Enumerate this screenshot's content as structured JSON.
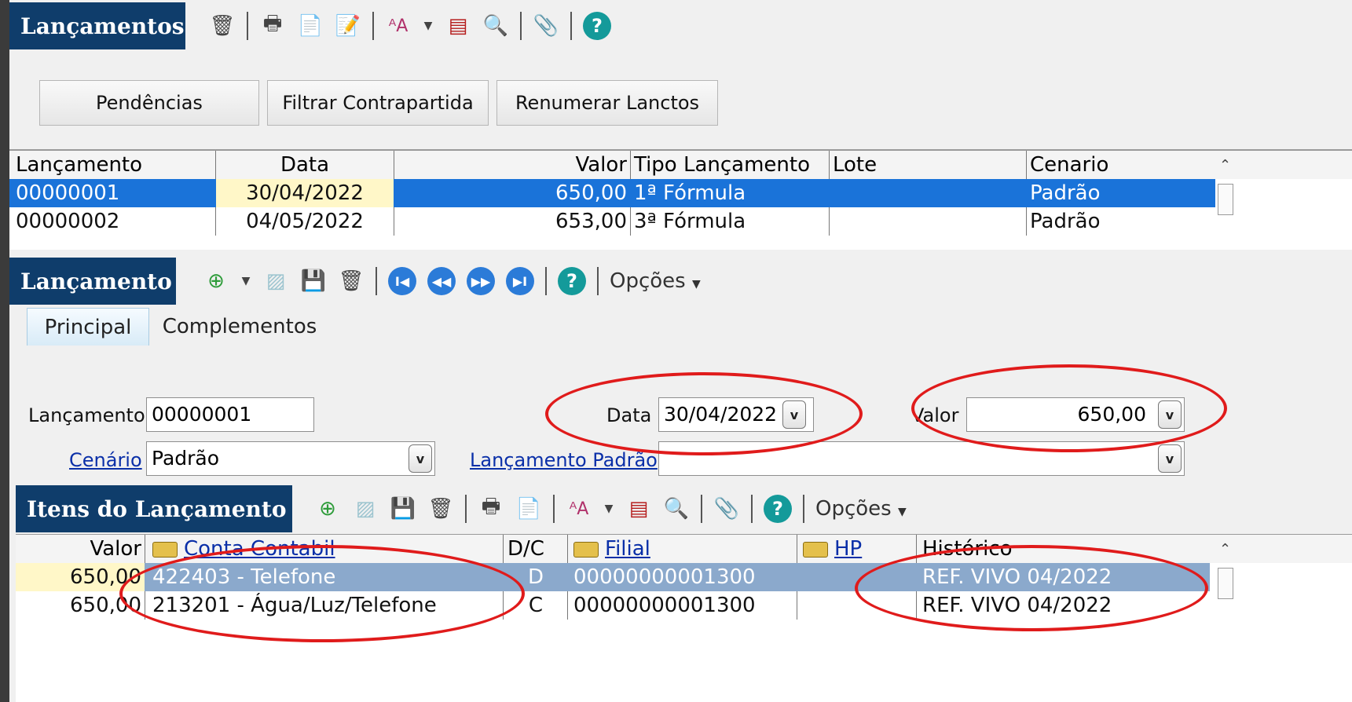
{
  "lancamentos": {
    "title": "Lançamentos",
    "toolbar_icons": [
      "trash-icon",
      "printer-icon",
      "export-icon",
      "edit-icon",
      "font-size-icon",
      "chevron-down-icon",
      "report-icon",
      "search-icon",
      "attach-icon",
      "help-icon"
    ],
    "help_label": "?",
    "buttons": [
      "Pendências",
      "Filtrar Contrapartida",
      "Renumerar Lanctos"
    ],
    "columns": [
      "Lançamento",
      "Data",
      "Valor",
      "Tipo Lançamento",
      "Lote",
      "Cenario"
    ],
    "rows": [
      {
        "lancamento": "00000001",
        "data": "30/04/2022",
        "valor": "650,00",
        "tipo": "1ª Fórmula",
        "lote": "",
        "cenario": "Padrão"
      },
      {
        "lancamento": "00000002",
        "data": "04/05/2022",
        "valor": "653,00",
        "tipo": "3ª Fórmula",
        "lote": "",
        "cenario": "Padrão"
      }
    ]
  },
  "lancamento": {
    "title": "Lançamento",
    "toolbar_icons": [
      "new-icon",
      "chevron-down-icon",
      "discard-icon",
      "save-icon",
      "trash-icon",
      "first-icon",
      "prev-icon",
      "next-icon",
      "last-icon",
      "help-icon"
    ],
    "nav": {
      "first": "I◀",
      "prev": "◀◀",
      "next": "▶▶",
      "last": "▶I"
    },
    "options_label": "Opções",
    "tabs": [
      "Principal",
      "Complementos"
    ],
    "fields": {
      "lancamento_label": "Lançamento",
      "lancamento_value": "00000001",
      "data_label": "Data",
      "data_value": "30/04/2022",
      "valor_label": "Valor",
      "valor_value": "650,00",
      "cenario_label": "Cenário",
      "cenario_value": "Padrão",
      "lancamento_padrao_label": "Lançamento Padrão",
      "lancamento_padrao_value": ""
    },
    "dropdown_glyph": "v"
  },
  "itens": {
    "title": "Itens do Lançamento",
    "options_label": "Opções",
    "columns": [
      "Valor",
      "Conta Contabil",
      "D/C",
      "Filial",
      "HP",
      "Histórico"
    ],
    "rows": [
      {
        "valor": "650,00",
        "conta": "422403 - Telefone",
        "dc": "D",
        "filial": "00000000001300",
        "hp": "",
        "historico": "REF. VIVO 04/2022"
      },
      {
        "valor": "650,00",
        "conta": "213201 - Água/Luz/Telefone",
        "dc": "C",
        "filial": "00000000001300",
        "hp": "",
        "historico": "REF. VIVO 04/2022"
      }
    ]
  },
  "colors": {
    "title_bg": "#0f3d6b",
    "selected_row": "#1a73d9",
    "annotation": "#e01b1b"
  }
}
